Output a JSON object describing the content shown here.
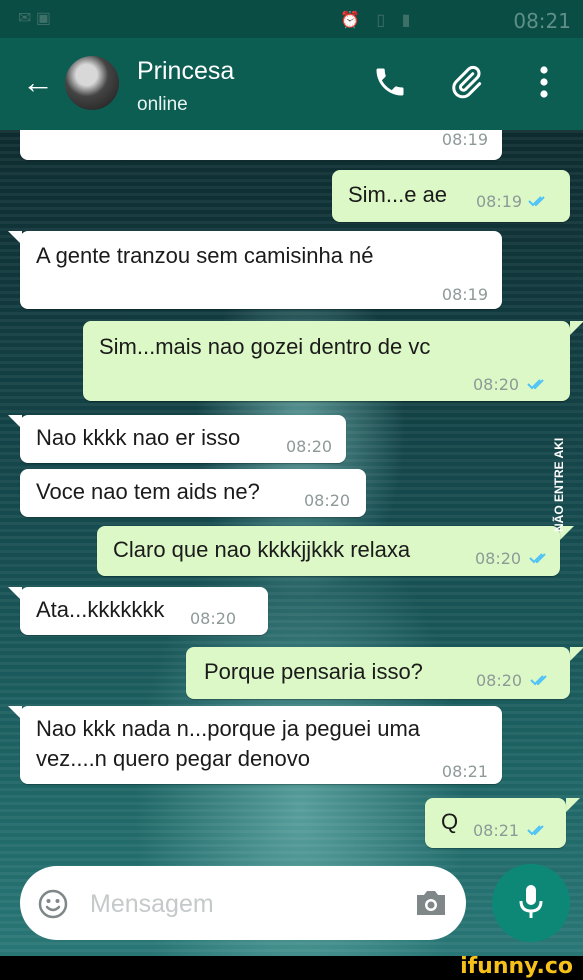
{
  "status_bar": {
    "time": "08:21"
  },
  "header": {
    "contact_name": "Princesa",
    "contact_status": "online",
    "icons": [
      "back-arrow-icon",
      "phone-icon",
      "paperclip-icon",
      "more-vert-icon"
    ]
  },
  "messages": [
    {
      "dir": "in",
      "text": "",
      "time": "08:19"
    },
    {
      "dir": "out",
      "text": "Sim...e ae",
      "time": "08:19",
      "read": true
    },
    {
      "dir": "in",
      "text": "A gente tranzou sem camisinha né",
      "time": "08:19"
    },
    {
      "dir": "out",
      "text": "Sim...mais nao gozei dentro de vc",
      "time": "08:20",
      "read": true
    },
    {
      "dir": "in",
      "text": "Nao kkkk nao er isso",
      "time": "08:20"
    },
    {
      "dir": "in",
      "text": "Voce nao tem aids ne?",
      "time": "08:20"
    },
    {
      "dir": "out",
      "text": "Claro que nao kkkkjjkkk relaxa",
      "time": "08:20",
      "read": true
    },
    {
      "dir": "in",
      "text": "Ata...kkkkkkk",
      "time": "08:20"
    },
    {
      "dir": "out",
      "text": "Porque pensaria isso?",
      "time": "08:20",
      "read": true
    },
    {
      "dir": "in",
      "text": "Nao kkk nada n...porque ja peguei uma",
      "text2": "vez....n quero pegar denovo",
      "time": "08:21"
    },
    {
      "dir": "out",
      "text": "Q",
      "time": "08:21",
      "read": true
    }
  ],
  "composer": {
    "placeholder": "Mensagem",
    "icons": [
      "emoji-icon",
      "camera-icon",
      "mic-icon"
    ]
  },
  "colors": {
    "header": "#0c5d52",
    "status_bar": "#0a4d45",
    "outgoing": "#dcf8c6",
    "incoming": "#ffffff",
    "read_ticks": "#4fc3f7",
    "mic_button": "#0d8877"
  },
  "watermark": {
    "side": "NÃO ENTRE AKI",
    "bottom": "ifunny.co"
  }
}
